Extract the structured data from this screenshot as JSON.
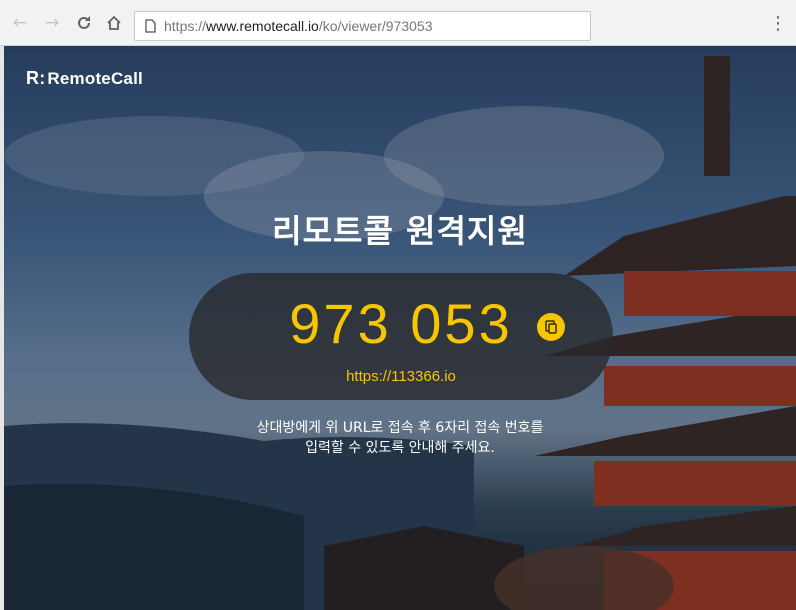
{
  "browser": {
    "back_icon": "arrow-left-icon",
    "forward_icon": "arrow-right-icon",
    "reload_icon": "reload-icon",
    "home_icon": "home-icon",
    "url_prefix": "https://",
    "url_host": "www.remotecall.io",
    "url_path": "/ko/viewer/973053",
    "menu_icon": "more-vertical-icon"
  },
  "page": {
    "logo_mark": "R:",
    "logo_text": "RemoteCall",
    "title": "리모트콜 원격지원",
    "code": "973 053",
    "copy_icon": "copy-icon",
    "connect_url": "https://113366.io",
    "instruction_line1": "상대방에게 위 URL로 접속 후 6자리 접속 번호를",
    "instruction_line2": "입력할 수 있도록 안내해 주세요."
  },
  "colors": {
    "accent": "#f7c600",
    "pill_bg": "#28282a"
  }
}
